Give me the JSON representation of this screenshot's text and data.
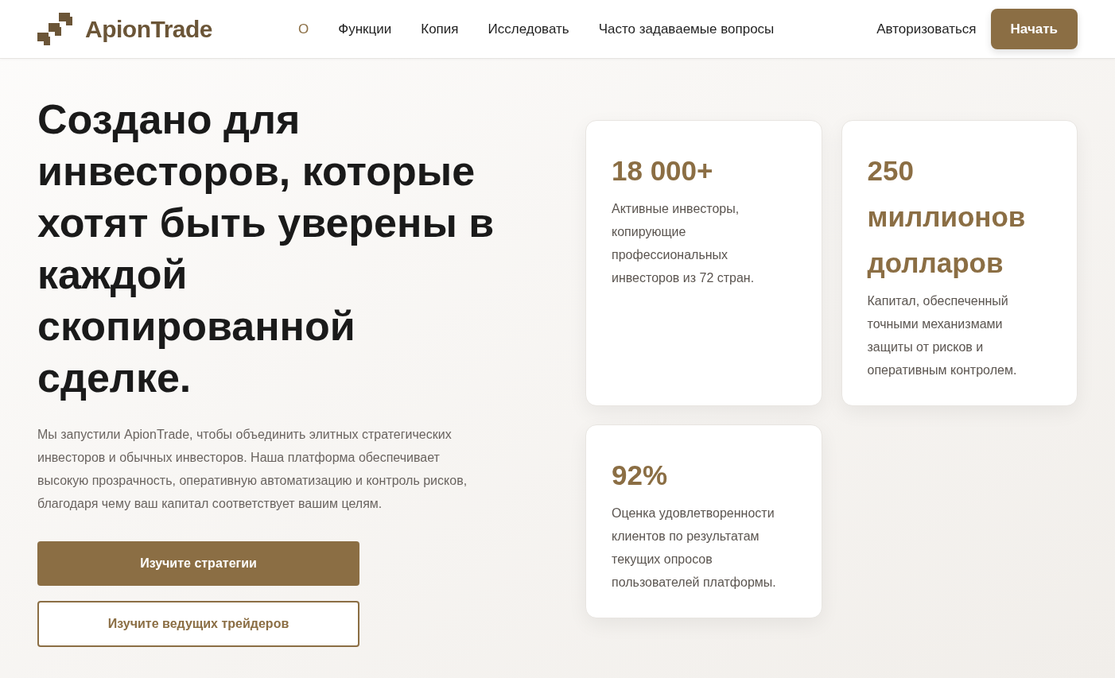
{
  "header": {
    "logo": {
      "text": "ApionTrade"
    },
    "nav": [
      {
        "label": "О",
        "selected": true
      },
      {
        "label": "Функции",
        "selected": false
      },
      {
        "label": "Копия",
        "selected": false
      },
      {
        "label": "Исследовать",
        "selected": false
      },
      {
        "label": "Часто задаваемые вопросы",
        "selected": false
      }
    ],
    "login": "Авторизоваться",
    "cta": "Начать"
  },
  "hero": {
    "title": "Создано для инвесторов, которые хотят быть уверены в каждой скопированной сделке.",
    "description": "Мы запустили ApionTrade, чтобы объединить элитных стратегических инвесторов и обычных инвесторов. Наша платформа обеспечивает высокую прозрачность, оперативную автоматизацию и контроль рисков, благодаря чему ваш капитал соответствует вашим целям.",
    "buttons": [
      {
        "label": "Изучите стратегии",
        "kind": "primary"
      },
      {
        "label": "Изучите ведущих трейдеров",
        "kind": "outline"
      }
    ]
  },
  "stats": [
    {
      "value": "18 000+",
      "caption": "Активные инвесторы, копирующие профессиональных инвесторов из 72 стран."
    },
    {
      "value": "250 миллионов долларов",
      "caption": "Капитал, обеспеченный точными механизмами защиты от рисков и оперативным контролем."
    },
    {
      "value": "92%",
      "caption": "Оценка удовлетворенности клиентов по результатам текущих опросов пользователей платформы."
    }
  ]
}
